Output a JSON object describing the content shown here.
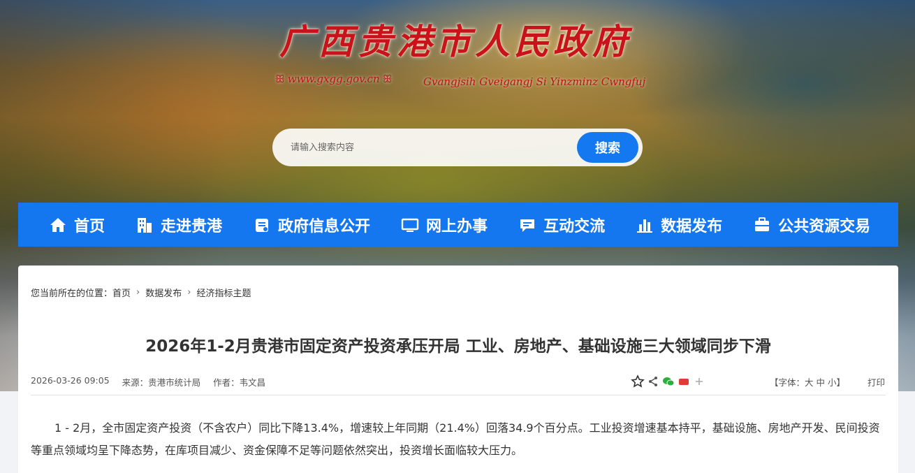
{
  "banner": {
    "site_title": "广西贵港市人民政府",
    "domain": "www.gxgg.gov.cn",
    "latin_name": "Gvangjsih Gveigangj Si Yinzminz Cwngfuj"
  },
  "search": {
    "placeholder": "请输入搜索内容",
    "button_label": "搜索"
  },
  "nav": {
    "items": [
      {
        "label": "首页",
        "icon": "home-icon"
      },
      {
        "label": "走进贵港",
        "icon": "building-icon"
      },
      {
        "label": "政府信息公开",
        "icon": "info-icon"
      },
      {
        "label": "网上办事",
        "icon": "monitor-icon"
      },
      {
        "label": "互动交流",
        "icon": "chat-icon"
      },
      {
        "label": "数据发布",
        "icon": "bar-chart-icon"
      },
      {
        "label": "公共资源交易",
        "icon": "briefcase-icon"
      }
    ]
  },
  "breadcrumb": {
    "prefix": "您当前所在的位置：",
    "items": [
      "首页",
      "数据发布",
      "经济指标主题"
    ]
  },
  "article": {
    "title": "2026年1-2月贵港市固定资产投资承压开局 工业、房地产、基础设施三大领域同步下滑",
    "date": "2026-03-26 09:05",
    "source": "来源：贵港市统计局",
    "author": "作者：韦文昌",
    "font_size_control": "【字体：大 中 小】",
    "print_label": "打印",
    "body": "1 - 2月，全市固定资产投资（不含农户）同比下降13.4%，增速较上年同期（21.4%）回落34.9个百分点。工业投资增速基本持平，基础设施、房地产开发、民间投资等重点领域均呈下降态势，在库项目减少、资金保障不足等问题依然突出，投资增长面临较大压力。"
  },
  "colors": {
    "nav_bg": "#1577f0",
    "search_button": "#1479f0",
    "title_red": "#c8131b"
  }
}
